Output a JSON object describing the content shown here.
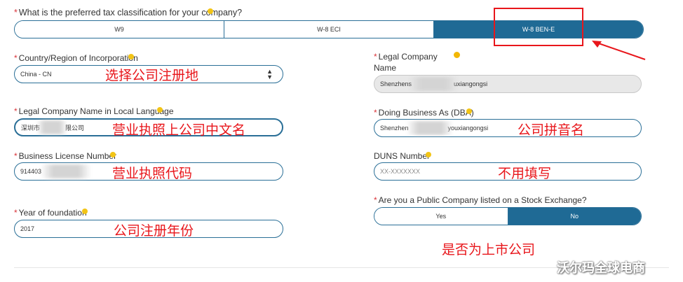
{
  "tax_question": "What is the preferred tax classification for your company?",
  "tax_options": [
    "W9",
    "W-8 ECI",
    "W-8 BEN-E"
  ],
  "tax_selected": "W-8 BEN-E",
  "fields": {
    "country_label": "Country/Region of Incorporation",
    "country_value": "China - CN",
    "legal_name_label_line1": "Legal Company",
    "legal_name_label_line2": "Name",
    "legal_name_value_start": "Shenzhens",
    "legal_name_value_end": "uxiangongsi",
    "local_name_label": "Legal Company Name in Local Language",
    "local_name_value_start": "深圳市",
    "local_name_value_end": "限公司",
    "dba_label": "Doing Business As (DBA)",
    "dba_value_start": "Shenzhen",
    "dba_value_end": "youxiangongsi",
    "license_label": "Business License Number",
    "license_value": "914403",
    "duns_label": "DUNS Number",
    "duns_placeholder": "XX-XXXXXXX",
    "year_label": "Year of foundation",
    "year_value": "2017",
    "public_question": "Are you a Public Company listed on a Stock Exchange?",
    "public_options": [
      "Yes",
      "No"
    ],
    "public_selected": "No"
  },
  "annotations": {
    "country": "选择公司注册地",
    "local_name": "营业执照上公司中文名",
    "dba": "公司拼音名",
    "license": "营业执照代码",
    "duns": "不用填写",
    "year": "公司注册年份",
    "public": "是否为上市公司"
  },
  "watermark": "沃尔玛全球电商",
  "colors": {
    "accent": "#1f6a95",
    "required": "#d9343a",
    "annotation": "#e8161b"
  }
}
